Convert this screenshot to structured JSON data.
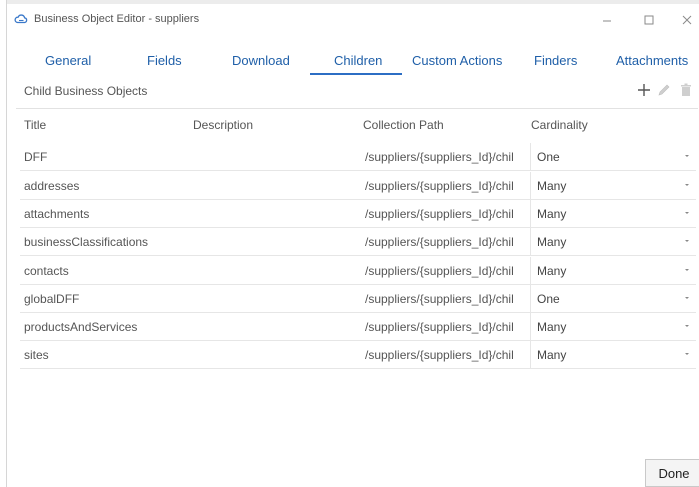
{
  "window": {
    "title": "Business Object Editor - suppliers"
  },
  "tabs": [
    {
      "label": "General"
    },
    {
      "label": "Fields"
    },
    {
      "label": "Download"
    },
    {
      "label": "Children"
    },
    {
      "label": "Custom Actions"
    },
    {
      "label": "Finders"
    },
    {
      "label": "Attachments"
    }
  ],
  "section": {
    "title": "Child Business Objects"
  },
  "table": {
    "headers": {
      "title": "Title",
      "description": "Description",
      "path": "Collection Path",
      "cardinality": "Cardinality"
    },
    "rows": [
      {
        "title": "DFF",
        "description": "",
        "path": "/suppliers/{suppliers_Id}/chil",
        "cardinality": "One"
      },
      {
        "title": "addresses",
        "description": "",
        "path": "/suppliers/{suppliers_Id}/chil",
        "cardinality": "Many"
      },
      {
        "title": "attachments",
        "description": "",
        "path": "/suppliers/{suppliers_Id}/chil",
        "cardinality": "Many"
      },
      {
        "title": "businessClassifications",
        "description": "",
        "path": "/suppliers/{suppliers_Id}/chil",
        "cardinality": "Many"
      },
      {
        "title": "contacts",
        "description": "",
        "path": "/suppliers/{suppliers_Id}/chil",
        "cardinality": "Many"
      },
      {
        "title": "globalDFF",
        "description": "",
        "path": "/suppliers/{suppliers_Id}/chil",
        "cardinality": "One"
      },
      {
        "title": "productsAndServices",
        "description": "",
        "path": "/suppliers/{suppliers_Id}/chil",
        "cardinality": "Many"
      },
      {
        "title": "sites",
        "description": "",
        "path": "/suppliers/{suppliers_Id}/chil",
        "cardinality": "Many"
      }
    ]
  },
  "footer": {
    "done_label": "Done"
  },
  "icons": {
    "app": "cloud-icon",
    "add": "plus-icon",
    "edit": "pencil-icon",
    "delete": "trash-icon",
    "dropdown": "chevron-down-icon"
  },
  "colors": {
    "accent": "#2c6ec4",
    "tab_text": "#1f5fa8",
    "text": "#555555"
  }
}
